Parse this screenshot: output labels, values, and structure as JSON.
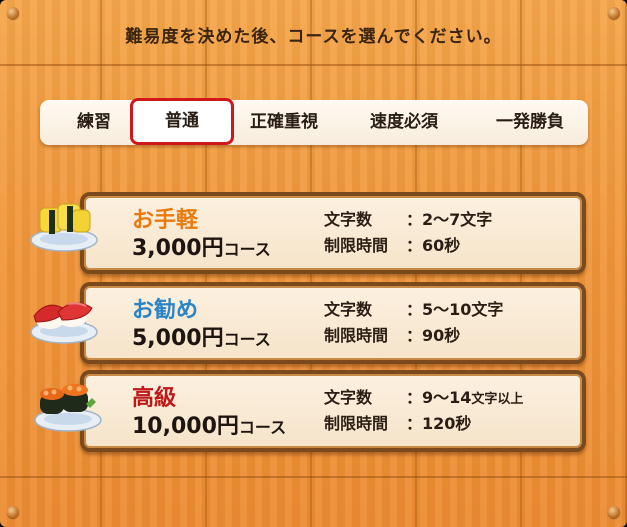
{
  "instruction": "難易度を決めた後、コースを選んでください。",
  "tabs": [
    {
      "label": "練習",
      "active": false
    },
    {
      "label": "普通",
      "active": true
    },
    {
      "label": "正確重視",
      "active": false
    },
    {
      "label": "速度必須",
      "active": false
    },
    {
      "label": "一発勝負",
      "active": false
    }
  ],
  "courses": [
    {
      "name": "お手軽",
      "name_color": "#e87a10",
      "price": "3,000円",
      "price_suffix": "コース",
      "chars_label": "文字数",
      "chars_value": "2～7文字",
      "chars_extra": "",
      "time_label": "制限時間",
      "time_value": "60秒",
      "plate_icon": "tamago-sushi-icon"
    },
    {
      "name": "お勧め",
      "name_color": "#2a84c8",
      "price": "5,000円",
      "price_suffix": "コース",
      "chars_label": "文字数",
      "chars_value": "5～10文字",
      "chars_extra": "",
      "time_label": "制限時間",
      "time_value": "90秒",
      "plate_icon": "maguro-sushi-icon"
    },
    {
      "name": "高級",
      "name_color": "#c01818",
      "price": "10,000円",
      "price_suffix": "コース",
      "chars_label": "文字数",
      "chars_value": "9～14",
      "chars_extra": "文字以上",
      "time_label": "制限時間",
      "time_value": "120秒",
      "plate_icon": "ikura-sushi-icon"
    }
  ]
}
